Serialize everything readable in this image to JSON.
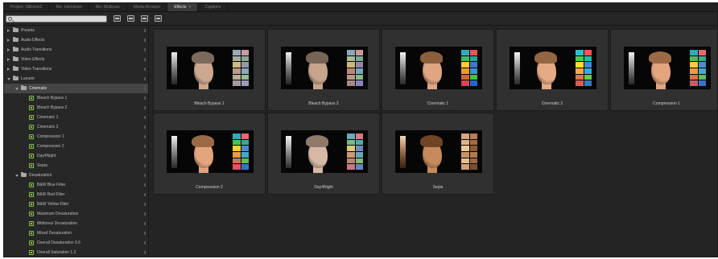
{
  "tabs": [
    {
      "label": "Project: Stillsmix2",
      "active": false
    },
    {
      "label": "Bin: Interviews",
      "active": false
    },
    {
      "label": "Bin: Multicam",
      "active": false
    },
    {
      "label": "Media Browser",
      "active": false
    },
    {
      "label": "Effects",
      "active": true,
      "close": "×"
    },
    {
      "label": "Captions",
      "active": false
    }
  ],
  "search": {
    "value": "",
    "placeholder": ""
  },
  "tree": [
    {
      "label": "Presets",
      "level": 0,
      "type": "folder",
      "expanded": false
    },
    {
      "label": "Audio Effects",
      "level": 0,
      "type": "folder",
      "expanded": false
    },
    {
      "label": "Audio Transitions",
      "level": 0,
      "type": "folder",
      "expanded": false
    },
    {
      "label": "Video Effects",
      "level": 0,
      "type": "folder",
      "expanded": false
    },
    {
      "label": "Video Transitions",
      "level": 0,
      "type": "folder",
      "expanded": false
    },
    {
      "label": "Lumetri",
      "level": 0,
      "type": "folder",
      "expanded": true
    },
    {
      "label": "Cinematic",
      "level": 1,
      "type": "folder",
      "expanded": true,
      "selected": true
    },
    {
      "label": "Bleach Bypass 1",
      "level": 2,
      "type": "preset"
    },
    {
      "label": "Bleach Bypass 2",
      "level": 2,
      "type": "preset"
    },
    {
      "label": "Cinematic 1",
      "level": 2,
      "type": "preset"
    },
    {
      "label": "Cinematic 2",
      "level": 2,
      "type": "preset"
    },
    {
      "label": "Compression 1",
      "level": 2,
      "type": "preset"
    },
    {
      "label": "Compression 2",
      "level": 2,
      "type": "preset"
    },
    {
      "label": "Day4Night",
      "level": 2,
      "type": "preset"
    },
    {
      "label": "Sepia",
      "level": 2,
      "type": "preset"
    },
    {
      "label": "Desaturation",
      "level": 1,
      "type": "folder",
      "expanded": true
    },
    {
      "label": "B&W Blue Filter",
      "level": 2,
      "type": "preset"
    },
    {
      "label": "B&W Red Filter",
      "level": 2,
      "type": "preset"
    },
    {
      "label": "B&W Yellow Filter",
      "level": 2,
      "type": "preset"
    },
    {
      "label": "Maximum Desaturation",
      "level": 2,
      "type": "preset"
    },
    {
      "label": "Midtones Desaturation",
      "level": 2,
      "type": "preset"
    },
    {
      "label": "Mixed Desaturation",
      "level": 2,
      "type": "preset"
    },
    {
      "label": "Overall Desaturation 0.6",
      "level": 2,
      "type": "preset"
    },
    {
      "label": "Overall Saturation 1.2",
      "level": 2,
      "type": "preset"
    }
  ],
  "thumbnails": [
    {
      "label": "Bleach Bypass 1",
      "look": "bleach"
    },
    {
      "label": "Bleach Bypass 2",
      "look": "bleach2"
    },
    {
      "label": "Cinematic 1",
      "look": "cinematic"
    },
    {
      "label": "Cinematic 2",
      "look": "cinematic2"
    },
    {
      "label": "Compression 1",
      "look": "warm"
    },
    {
      "label": "Compression 2",
      "look": "warm"
    },
    {
      "label": "Day4Night",
      "look": "day4night"
    },
    {
      "label": "Sepia",
      "look": "sepia"
    }
  ],
  "colors": {
    "panel": "#2a2a2a",
    "active_tab": "#3b3b3b",
    "preset_icon": "#8fc04a",
    "selection": "#454545"
  }
}
